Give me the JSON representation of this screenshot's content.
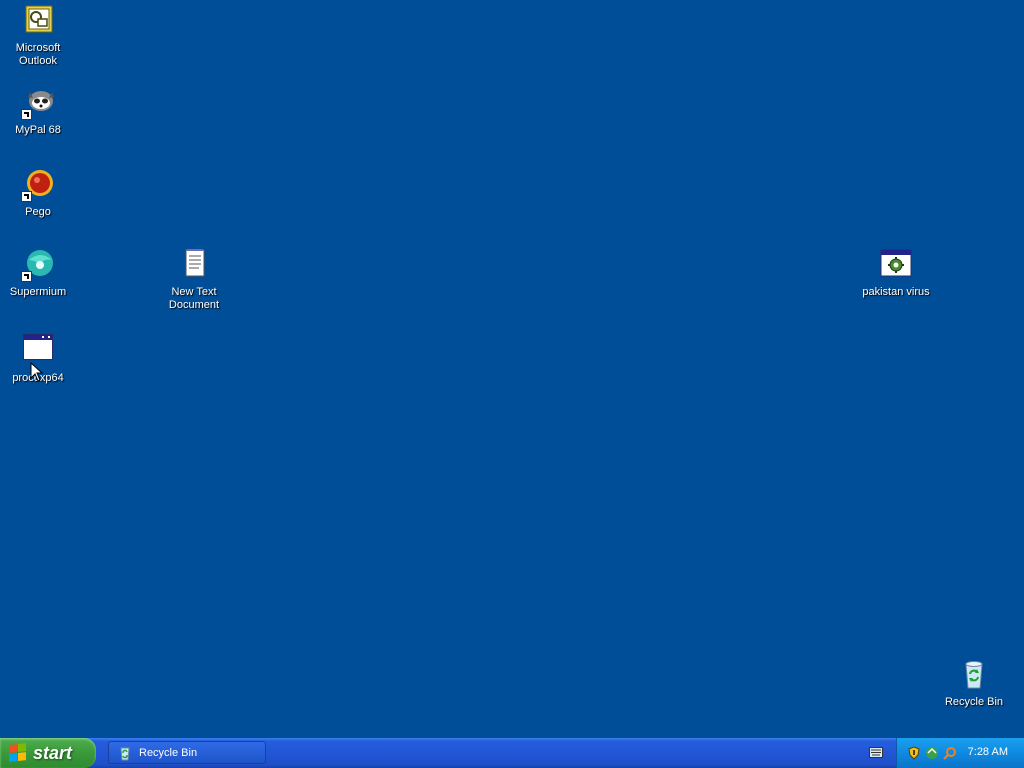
{
  "desktop": {
    "icons": [
      {
        "label_line1": "Microsoft",
        "label_line2": "Outlook",
        "icon": "outlook-icon"
      },
      {
        "label": "MyPal 68",
        "icon": "mypal-icon"
      },
      {
        "label": "Pego",
        "icon": "pego-icon"
      },
      {
        "label": "Supermium",
        "icon": "supermium-icon"
      },
      {
        "label_line1": "New Text",
        "label_line2": "Document",
        "icon": "text-document-icon"
      },
      {
        "label": "pakistan virus",
        "icon": "application-icon"
      },
      {
        "label": "procexp64",
        "icon": "application-window-icon"
      },
      {
        "label": "Recycle Bin",
        "icon": "recycle-bin-icon"
      }
    ]
  },
  "taskbar": {
    "start_label": "start",
    "task_items": [
      {
        "label": "Recycle Bin"
      }
    ],
    "clock": "7:28 AM"
  },
  "colors": {
    "desktop_bg": "#004e98",
    "taskbar": "#245edb",
    "start": "#3a9a3a",
    "tray": "#0f8ae0"
  }
}
